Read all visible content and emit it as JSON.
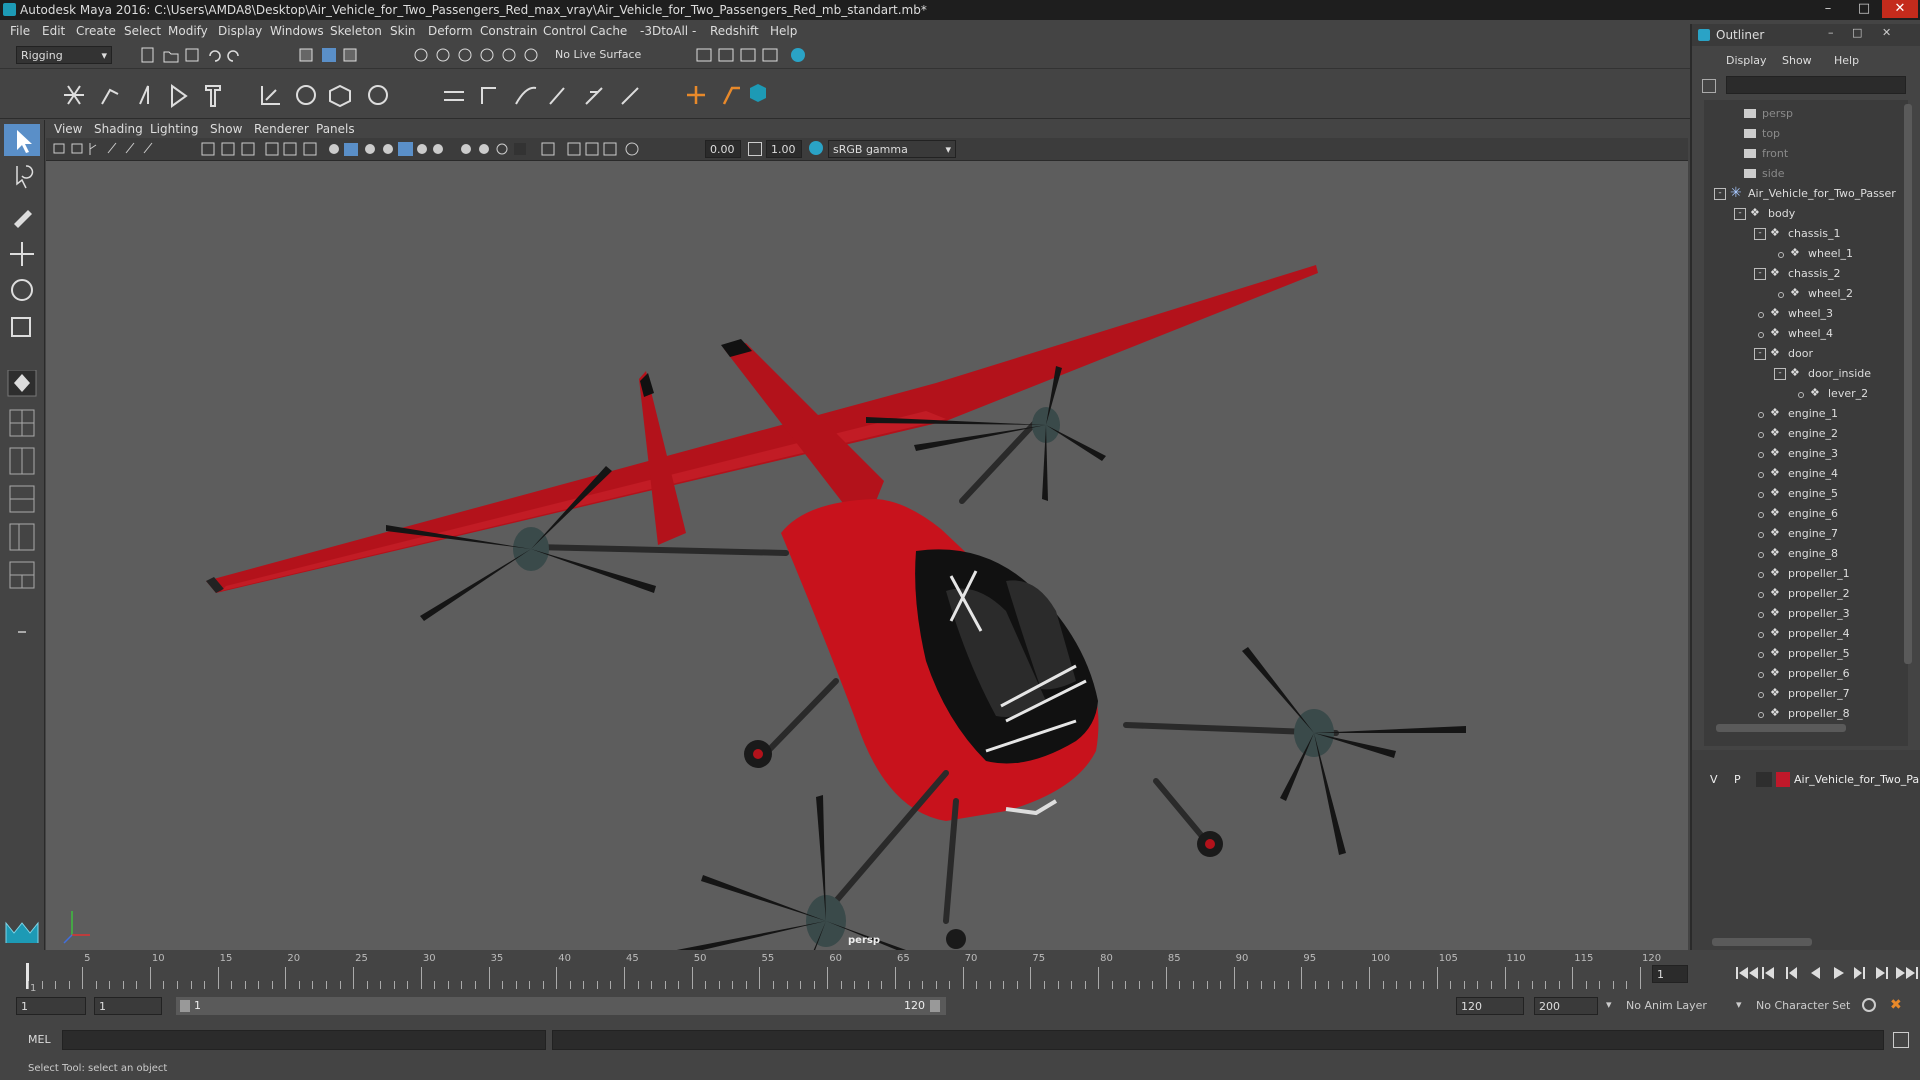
{
  "window": {
    "title": "Autodesk Maya 2016: C:\\Users\\AMDA8\\Desktop\\Air_Vehicle_for_Two_Passengers_Red_max_vray\\Air_Vehicle_for_Two_Passengers_Red_mb_standart.mb*"
  },
  "menubar": [
    "File",
    "Edit",
    "Create",
    "Select",
    "Modify",
    "Display",
    "Windows",
    "Skeleton",
    "Skin",
    "Deform",
    "Constrain",
    "Control",
    "Cache",
    "-3DtoAll -",
    "Redshift",
    "Help"
  ],
  "statusline": {
    "mode": "Rigging",
    "live_surface": "No Live Surface"
  },
  "panel": {
    "menus": [
      "View",
      "Shading",
      "Lighting",
      "Show",
      "Renderer",
      "Panels"
    ],
    "exposure": "0.00",
    "gamma": "1.00",
    "colorspace": "sRGB gamma",
    "camera_label": "persp"
  },
  "outliner": {
    "title": "Outliner",
    "menus": [
      "Display",
      "Show",
      "Help"
    ],
    "items": [
      {
        "label": "persp",
        "depth": 0,
        "type": "camera",
        "dim": true
      },
      {
        "label": "top",
        "depth": 0,
        "type": "camera",
        "dim": true
      },
      {
        "label": "front",
        "depth": 0,
        "type": "camera",
        "dim": true
      },
      {
        "label": "side",
        "depth": 0,
        "type": "camera",
        "dim": true
      },
      {
        "label": "Air_Vehicle_for_Two_Passer",
        "depth": 0,
        "type": "group",
        "expand": "-"
      },
      {
        "label": "body",
        "depth": 1,
        "type": "mesh",
        "expand": "-"
      },
      {
        "label": "chassis_1",
        "depth": 2,
        "type": "mesh",
        "expand": "-"
      },
      {
        "label": "wheel_1",
        "depth": 3,
        "type": "mesh"
      },
      {
        "label": "chassis_2",
        "depth": 2,
        "type": "mesh",
        "expand": "-"
      },
      {
        "label": "wheel_2",
        "depth": 3,
        "type": "mesh"
      },
      {
        "label": "wheel_3",
        "depth": 2,
        "type": "mesh"
      },
      {
        "label": "wheel_4",
        "depth": 2,
        "type": "mesh"
      },
      {
        "label": "door",
        "depth": 2,
        "type": "mesh",
        "expand": "-"
      },
      {
        "label": "door_inside",
        "depth": 3,
        "type": "mesh",
        "expand": "-"
      },
      {
        "label": "lever_2",
        "depth": 4,
        "type": "mesh"
      },
      {
        "label": "engine_1",
        "depth": 2,
        "type": "mesh"
      },
      {
        "label": "engine_2",
        "depth": 2,
        "type": "mesh"
      },
      {
        "label": "engine_3",
        "depth": 2,
        "type": "mesh"
      },
      {
        "label": "engine_4",
        "depth": 2,
        "type": "mesh"
      },
      {
        "label": "engine_5",
        "depth": 2,
        "type": "mesh"
      },
      {
        "label": "engine_6",
        "depth": 2,
        "type": "mesh"
      },
      {
        "label": "engine_7",
        "depth": 2,
        "type": "mesh"
      },
      {
        "label": "engine_8",
        "depth": 2,
        "type": "mesh"
      },
      {
        "label": "propeller_1",
        "depth": 2,
        "type": "mesh"
      },
      {
        "label": "propeller_2",
        "depth": 2,
        "type": "mesh"
      },
      {
        "label": "propeller_3",
        "depth": 2,
        "type": "mesh"
      },
      {
        "label": "propeller_4",
        "depth": 2,
        "type": "mesh"
      },
      {
        "label": "propeller_5",
        "depth": 2,
        "type": "mesh"
      },
      {
        "label": "propeller_6",
        "depth": 2,
        "type": "mesh"
      },
      {
        "label": "propeller_7",
        "depth": 2,
        "type": "mesh"
      },
      {
        "label": "propeller_8",
        "depth": 2,
        "type": "mesh"
      }
    ]
  },
  "layers": {
    "visible": "V",
    "playback": "P",
    "name": "Air_Vehicle_for_Two_Pa",
    "color": "#c0182a"
  },
  "timeline": {
    "ticks": [
      "1",
      "5",
      "10",
      "15",
      "20",
      "25",
      "30",
      "35",
      "40",
      "45",
      "50",
      "55",
      "60",
      "65",
      "70",
      "75",
      "80",
      "85",
      "90",
      "95",
      "100",
      "105",
      "110",
      "115",
      "120"
    ],
    "current_frame": "1"
  },
  "range": {
    "start": "1",
    "current": "1",
    "slider_start": "1",
    "slider_end": "120",
    "end": "120",
    "max": "200",
    "anim_layer": "No Anim Layer",
    "character_set": "No Character Set"
  },
  "cmdline": {
    "label": "MEL"
  },
  "help": {
    "text": "Select Tool: select an object"
  },
  "colors": {
    "accent": "#5a8fc8",
    "vehicle_red": "#c8121c",
    "viewport_bg": "#5d5d5d"
  }
}
